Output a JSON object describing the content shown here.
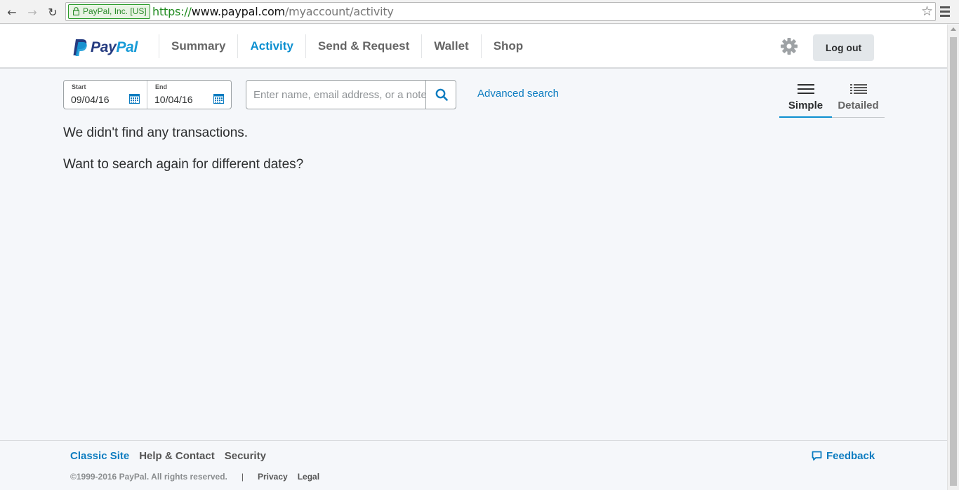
{
  "browser": {
    "back_icon": "←",
    "forward_icon": "→",
    "reload_icon": "↻",
    "ev_label": "PayPal, Inc. [US]",
    "url_scheme": "https://",
    "url_host": "www.paypal.com",
    "url_path": "/myaccount/activity",
    "star_icon": "☆"
  },
  "header": {
    "logo_pay": "Pay",
    "logo_pal": "Pal",
    "nav": [
      "Summary",
      "Activity",
      "Send & Request",
      "Wallet",
      "Shop"
    ],
    "active_nav": "Activity",
    "logout_label": "Log out"
  },
  "filters": {
    "start_label": "Start",
    "start_value": "09/04/16",
    "end_label": "End",
    "end_value": "10/04/16",
    "search_placeholder": "Enter name, email address, or a note",
    "advanced_search": "Advanced search",
    "views": [
      "Simple",
      "Detailed"
    ],
    "active_view": "Simple"
  },
  "content": {
    "no_results": "We didn't find any transactions.",
    "retry": "Want to search again for different dates?"
  },
  "footer": {
    "links": [
      "Classic Site",
      "Help & Contact",
      "Security"
    ],
    "feedback": "Feedback",
    "copyright": "©1999-2016 PayPal. All rights reserved.",
    "divider": "|",
    "privacy": "Privacy",
    "legal": "Legal"
  },
  "colors": {
    "accent": "#0c8fd0",
    "link": "#0c7cc0",
    "paypal_dark": "#253b80",
    "paypal_light": "#179bd7"
  }
}
